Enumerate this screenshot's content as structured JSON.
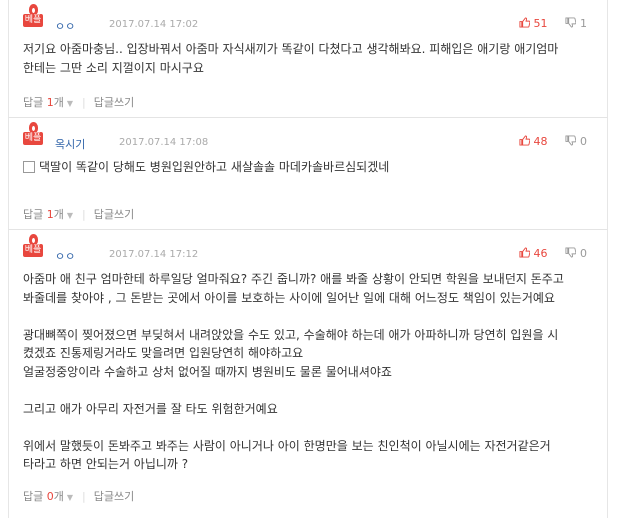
{
  "best_label": "베플",
  "reply_label": "답글",
  "reply_unit": "개",
  "write_reply_label": "답글쓰기",
  "comments": [
    {
      "nick": "ㅇㅇ",
      "date": "2017.07.14 17:02",
      "likes": "51",
      "dislikes": "1",
      "text": "저기요 아줌마충님.. 입장바꿔서 아줌마 자식새끼가 똑같이 다쳤다고 생각해봐요. 피해입은 애기랑 애기엄마\n한테는 그딴 소리 지껄이지 마시구요",
      "reply_count": "1"
    },
    {
      "nick": "옥시기",
      "date": "2017.07.14 17:08",
      "likes": "48",
      "dislikes": "0",
      "text": "댁딸이 똑같이 당해도 병원입원안하고 새살솔솔 마데카솔바르심되겠네",
      "reply_count": "1"
    },
    {
      "nick": "ㅇㅇ",
      "date": "2017.07.14 17:12",
      "likes": "46",
      "dislikes": "0",
      "text": "아줌마 애 친구 엄마한테 하루일당 얼마줘요? 주긴 줍니까? 애를 봐줄 상황이 안되면 학원을 보내던지 돈주고\n봐줄데를 찾아야 , 그 돈받는 곳에서 아이를 보호하는 사이에 일어난 일에 대해 어느정도 책임이 있는거예요\n\n광대뼈쪽이 찢어졌으면 부딪혀서 내려앉았을 수도 있고, 수술해야 하는데 애가 아파하니까 당연히 입원을 시\n켰겠죠 진통제링거라도 맞을려면 입원당연히 해야하고요\n얼굴정중앙이라 수술하고 상처 없어질 때까지 병원비도 물론 물어내셔야죠\n\n그리고 애가 아무리 자전거를 잘 타도 위험한거예요\n\n위에서 말했듯이 돈봐주고 봐주는 사람이 아니거나 아이 한명만을 보는 친인척이 아닐시에는 자전거같은거\n타라고 하면 안되는거 아닙니까 ?",
      "reply_count": "0"
    }
  ]
}
